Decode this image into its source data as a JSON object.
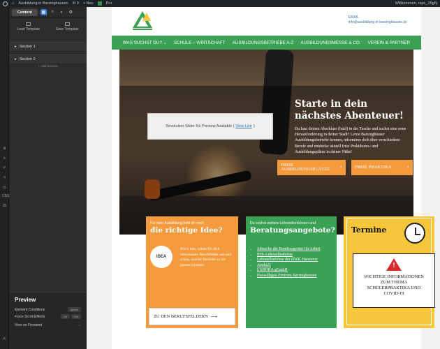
{
  "adminbar": {
    "site": "Ausbildung in Barsinghausen",
    "comments": "0",
    "new_label": "+ Neu",
    "pro": "Pro",
    "greeting": "Willkommen, raye_25g6j"
  },
  "panel": {
    "tab_content": "Content",
    "load_template": "Load Template",
    "save_template": "Save Template",
    "sections": [
      "Section 1",
      "Section 2"
    ],
    "add_section": "+ Add Section",
    "rail_labels": [
      "CSS",
      "JS"
    ]
  },
  "preview": {
    "title": "Preview",
    "element_conditions": "Element Conditions",
    "element_conditions_value": "Ignore",
    "force_scroll": "Force Scroll Effects",
    "force_scroll_on": "On",
    "force_scroll_off": "Out",
    "view_frontend": "View on Frontend"
  },
  "site": {
    "email_label": "EMAIL",
    "email": "info@ausbildung-in-barsinghausen.de",
    "nav": [
      "WAS SUCHST DU?",
      "SCHULE – WIRTSCHAFT",
      "AUSBILDUNGSBETRIEBE A-Z",
      "AUSBILDUNGSMESSE & CO.",
      "VEREIN & PARTNER"
    ]
  },
  "hero": {
    "slider_notice": "Revolution Slider No Preview Available (",
    "slider_link": "View Live",
    "slider_close": ")",
    "title": "Starte in dein nächstes Abenteuer!",
    "text": "Du hast deinen Abschluss (bald) in der Tasche und suchst eine neue Herausforderung in deiner Stadt? Lerne Barsinghäuser Ausbildungsbetriebe kennen, informiere dich über verschiedene Berufe und entdecke aktuell freie Praktikums- und Ausbildungsplätze in deiner Nähe!",
    "btn1": "FREIE AUSBILDUNGSPLÄTZE",
    "btn2": "FREIE PRAKTIKA"
  },
  "cards": {
    "orange": {
      "kicker": "Für eine Ausbildung fehlt dir noch",
      "title": "die richtige Idee?",
      "idea": "IDEA",
      "text": "Klick hier, wähle für dich interessante Berufsfelder aus und schau, welche Betriebe zu dir passen könnten.",
      "button": "ZU DEN BERUFSFELDERN"
    },
    "green": {
      "kicker": "Du suchst weitere Lehrstellenbörsen und",
      "title": "Beratungsangebote?",
      "links": [
        "Jobsuche der Bundesagentur für Arbeit",
        "IHK-Lehrstellenbörse",
        "Lehrstellenbörse der HWK Hannover",
        "Azubi21",
        "LABORA gGmbH",
        "Freiwilligen Zentrum Barsinghausen"
      ]
    },
    "yellow": {
      "title": "Termine",
      "warning": "WICHTIGE INFORMATIONEN ZUM THEMA SCHÜLERPRAKTIKA UND COVID-19"
    }
  },
  "colors": {
    "green": "#3aa155",
    "orange": "#f39a3c",
    "yellow": "#f7c63b",
    "panel": "#2c2c2c"
  }
}
